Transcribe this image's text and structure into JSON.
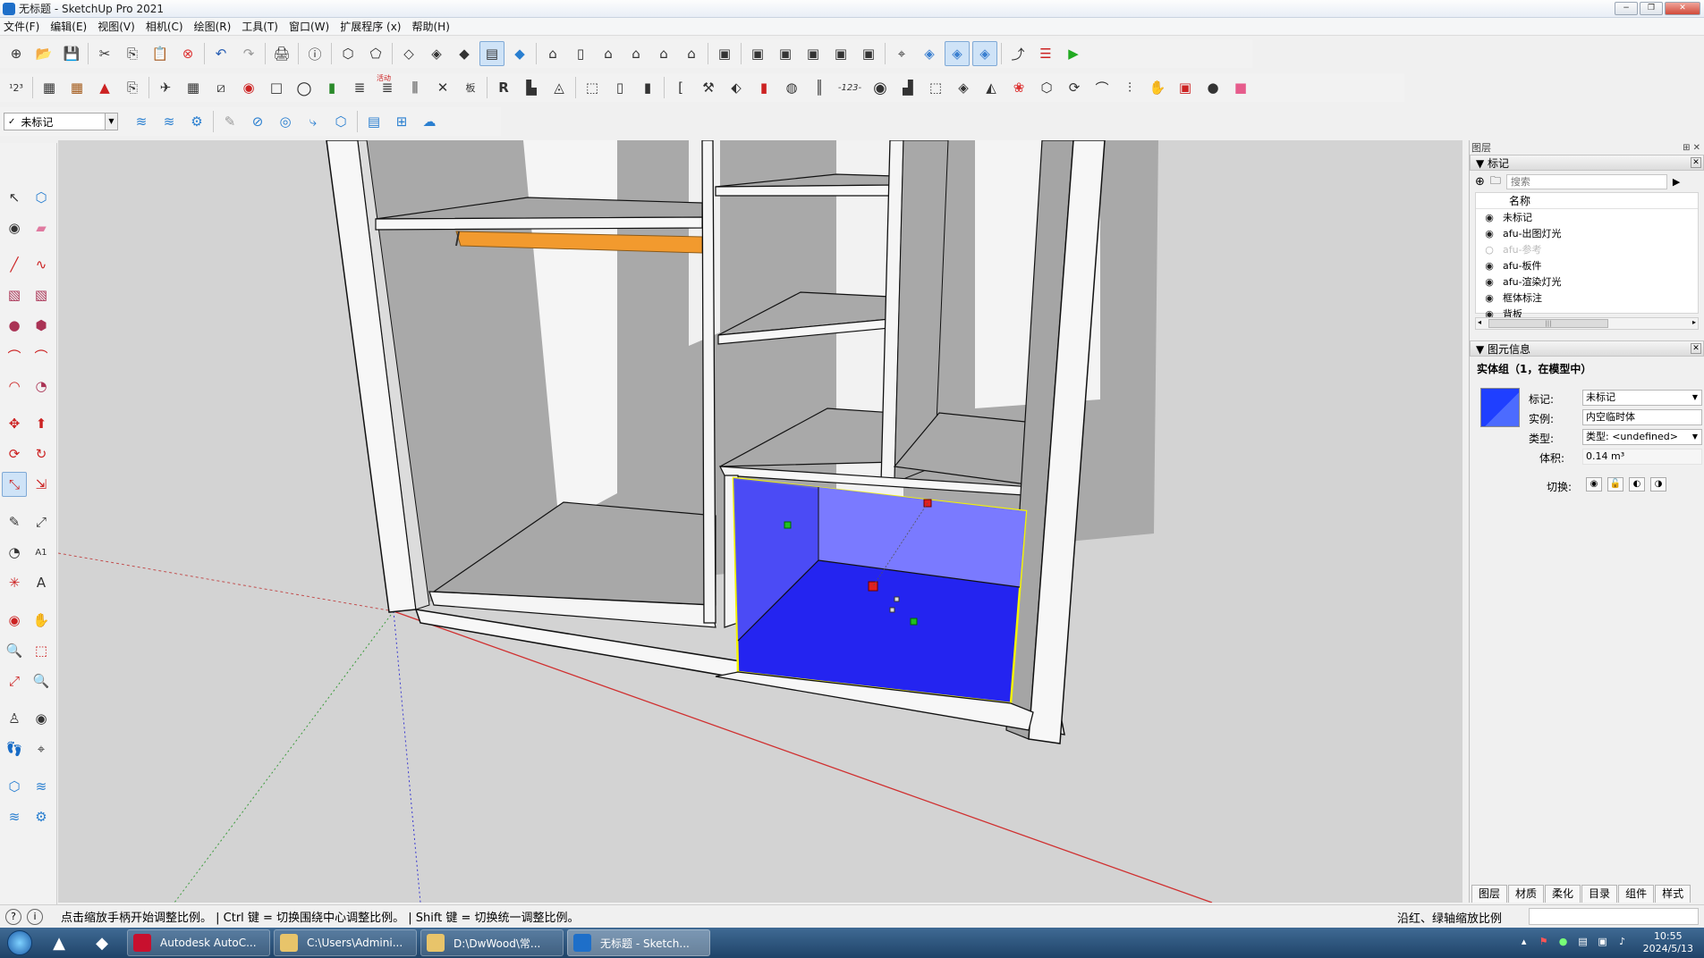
{
  "window": {
    "title": "无标题 - SketchUp Pro 2021",
    "controls": [
      "−",
      "❐",
      "✕"
    ]
  },
  "menu": [
    "文件(F)",
    "编辑(E)",
    "视图(V)",
    "相机(C)",
    "绘图(R)",
    "工具(T)",
    "窗口(W)",
    "扩展程序 (x)",
    "帮助(H)"
  ],
  "tag_dropdown": {
    "value": "未标记"
  },
  "toolbar_text": {
    "plugin_badge": "活动",
    "board_label": "板",
    "num_label": "-123-"
  },
  "panel": {
    "title": "图层",
    "tags_section": {
      "title": "标记",
      "search_placeholder": "搜索",
      "column_name": "名称",
      "rows": [
        {
          "name": "未标记",
          "visible": true
        },
        {
          "name": "afu-出图灯光",
          "visible": true
        },
        {
          "name": "afu-参考",
          "visible": false
        },
        {
          "name": "afu-板件",
          "visible": true
        },
        {
          "name": "afu-渲染灯光",
          "visible": true
        },
        {
          "name": "框体标注",
          "visible": true
        },
        {
          "name": "背板",
          "visible": true
        }
      ]
    },
    "entity_section": {
      "title": "图元信息",
      "heading": "实体组（1，在模型中）",
      "tag_label": "标记:",
      "tag_value": "未标记",
      "instance_label": "实例:",
      "instance_value": "内空临时体",
      "type_label": "类型:",
      "type_value": "类型: <undefined>",
      "volume_label": "体积:",
      "volume_value": "0.14 m³",
      "toggle_label": "切换:",
      "swatch_color": "#1f3fff"
    },
    "tabs": [
      "图层",
      "材质",
      "柔化",
      "目录",
      "组件",
      "样式"
    ]
  },
  "statusbar": {
    "message": "点击缩放手柄开始调整比例。 | Ctrl 键 = 切换围绕中心调整比例。 | Shift 键 = 切换统一调整比例。",
    "right_text": "沿红、绿轴缩放比例"
  },
  "taskbar": {
    "tasks": [
      {
        "label": "Autodesk AutoC...",
        "color": "#c8102e"
      },
      {
        "label": "C:\\Users\\Admini...",
        "color": "#e8c46a"
      },
      {
        "label": "D:\\DwWood\\常...",
        "color": "#e8c46a"
      },
      {
        "label": "无标题 - Sketch...",
        "color": "#1e6fc9"
      }
    ],
    "time": "10:55",
    "date": "2024/5/13"
  },
  "colors": {
    "selection_blue": "#2424f0",
    "selection_outline": "#f5f500",
    "hanging_rod": "#f29a2e",
    "board_white": "#f7f7f7",
    "board_gray": "#a6a6a6"
  }
}
